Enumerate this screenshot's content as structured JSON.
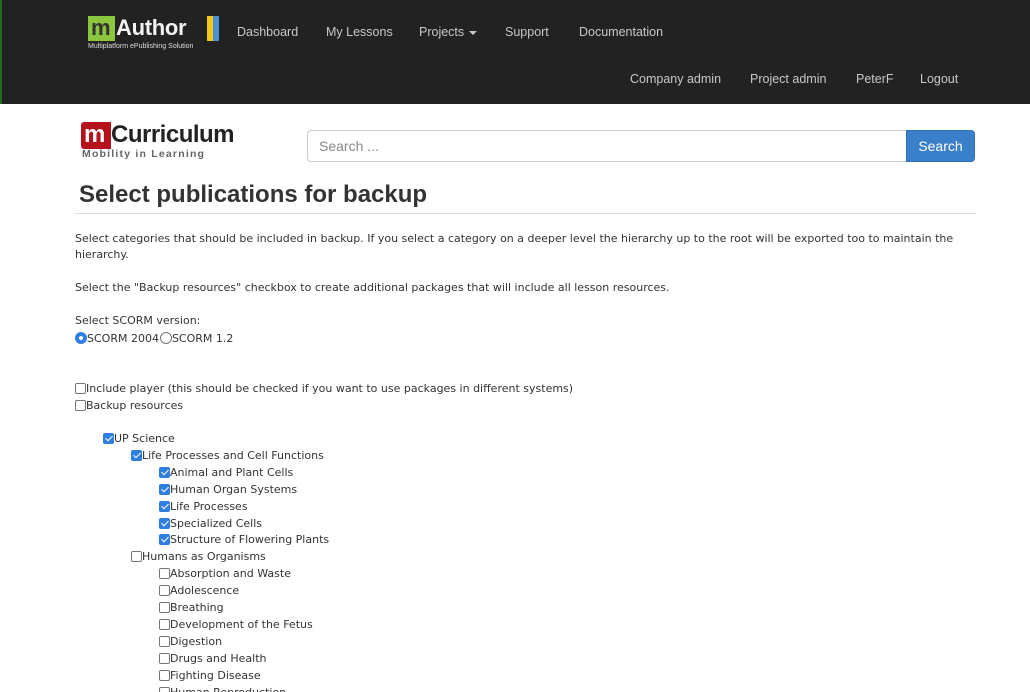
{
  "navbar": {
    "brand": {
      "m": "m",
      "word": "Author",
      "tagline": "Multiplatform ePublishing Solution",
      "colors": [
        "#8cc63f",
        "#f5c518",
        "#4a90d9"
      ]
    },
    "links": [
      "Dashboard",
      "My Lessons",
      "Projects",
      "Support",
      "Documentation"
    ],
    "right_links": [
      "Company admin",
      "Project admin",
      "PeterF",
      "Logout"
    ]
  },
  "logo": {
    "m": "m",
    "word": "Curriculum",
    "tagline": "Mobility in Learning",
    "accent": "#b5121b"
  },
  "search": {
    "placeholder": "Search ...",
    "value": "",
    "button": "Search"
  },
  "main": {
    "title": "Select publications for backup",
    "intro": "Select categories that should be included in backup. If you select a category on a deeper level the hierarchy up to the root will be exported too to maintain the hierarchy.",
    "resources_hint": "Select the \"Backup resources\" checkbox to create additional packages that will include all lesson resources.",
    "scorm_label": "Select SCORM version:",
    "scorm_options": [
      {
        "label": "SCORM 2004",
        "selected": true
      },
      {
        "label": "SCORM 1.2",
        "selected": false
      }
    ],
    "options": [
      {
        "label": "Include player (this should be checked if you want to use packages in different systems)",
        "checked": false
      },
      {
        "label": "Backup resources",
        "checked": false
      }
    ],
    "tree": [
      {
        "label": "UP Science",
        "checked": true,
        "level": 0
      },
      {
        "label": "Life Processes and Cell Functions",
        "checked": true,
        "level": 1
      },
      {
        "label": "Animal and Plant Cells",
        "checked": true,
        "level": 2
      },
      {
        "label": "Human Organ Systems",
        "checked": true,
        "level": 2
      },
      {
        "label": "Life Processes",
        "checked": true,
        "level": 2
      },
      {
        "label": "Specialized Cells",
        "checked": true,
        "level": 2
      },
      {
        "label": "Structure of Flowering Plants",
        "checked": true,
        "level": 2
      },
      {
        "label": "Humans as Organisms",
        "checked": false,
        "level": 1
      },
      {
        "label": "Absorption and Waste",
        "checked": false,
        "level": 2
      },
      {
        "label": "Adolescence",
        "checked": false,
        "level": 2
      },
      {
        "label": "Breathing",
        "checked": false,
        "level": 2
      },
      {
        "label": "Development of the Fetus",
        "checked": false,
        "level": 2
      },
      {
        "label": "Digestion",
        "checked": false,
        "level": 2
      },
      {
        "label": "Drugs and Health",
        "checked": false,
        "level": 2
      },
      {
        "label": "Fighting Disease",
        "checked": false,
        "level": 2
      },
      {
        "label": "Human Reproduction",
        "checked": false,
        "level": 2
      }
    ]
  }
}
